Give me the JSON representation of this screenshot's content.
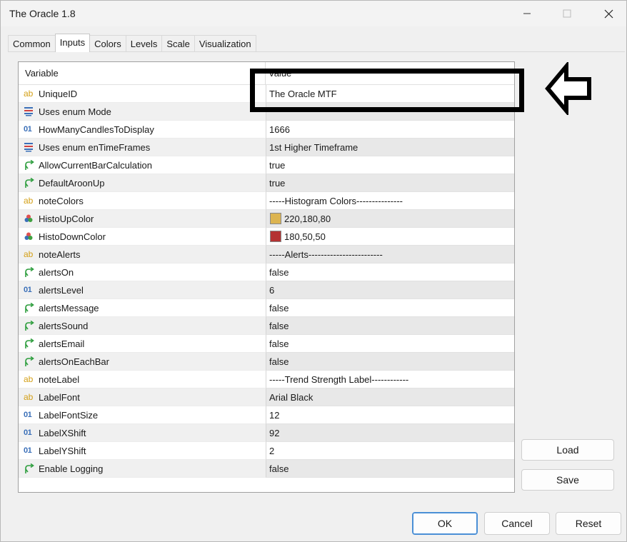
{
  "window": {
    "title": "The Oracle 1.8"
  },
  "tabs": [
    {
      "label": "Common",
      "active": false
    },
    {
      "label": "Inputs",
      "active": true
    },
    {
      "label": "Colors",
      "active": false
    },
    {
      "label": "Levels",
      "active": false
    },
    {
      "label": "Scale",
      "active": false
    },
    {
      "label": "Visualization",
      "active": false
    }
  ],
  "grid": {
    "headers": {
      "variable": "Variable",
      "value": "Value"
    },
    "rows": [
      {
        "name": "UniqueID",
        "icon": "ab",
        "value": "The Oracle MTF"
      },
      {
        "name": "Uses enum Mode",
        "icon": "enum",
        "value": ""
      },
      {
        "name": "HowManyCandlesToDisplay",
        "icon": "num",
        "value": "1666"
      },
      {
        "name": "Uses enum enTimeFrames",
        "icon": "enum",
        "value": "1st Higher Timeframe"
      },
      {
        "name": "AllowCurrentBarCalculation",
        "icon": "bool",
        "value": "true"
      },
      {
        "name": "DefaultAroonUp",
        "icon": "bool",
        "value": "true"
      },
      {
        "name": "noteColors",
        "icon": "ab",
        "value": "-----Histogram Colors---------------"
      },
      {
        "name": "HistoUpColor",
        "icon": "color",
        "value": "220,180,80",
        "swatch": "#dcb450"
      },
      {
        "name": "HistoDownColor",
        "icon": "color",
        "value": "180,50,50",
        "swatch": "#b43232"
      },
      {
        "name": "noteAlerts",
        "icon": "ab",
        "value": "-----Alerts------------------------"
      },
      {
        "name": "alertsOn",
        "icon": "bool",
        "value": "false"
      },
      {
        "name": "alertsLevel",
        "icon": "num",
        "value": "6"
      },
      {
        "name": "alertsMessage",
        "icon": "bool",
        "value": "false"
      },
      {
        "name": "alertsSound",
        "icon": "bool",
        "value": "false"
      },
      {
        "name": "alertsEmail",
        "icon": "bool",
        "value": "false"
      },
      {
        "name": "alertsOnEachBar",
        "icon": "bool",
        "value": "false"
      },
      {
        "name": "noteLabel",
        "icon": "ab",
        "value": "-----Trend Strength Label------------"
      },
      {
        "name": "LabelFont",
        "icon": "ab",
        "value": "Arial Black"
      },
      {
        "name": "LabelFontSize",
        "icon": "num",
        "value": "12"
      },
      {
        "name": "LabelXShift",
        "icon": "num",
        "value": "92"
      },
      {
        "name": "LabelYShift",
        "icon": "num",
        "value": "2"
      },
      {
        "name": "Enable Logging",
        "icon": "bool",
        "value": "false"
      }
    ]
  },
  "side_buttons": {
    "load": "Load",
    "save": "Save"
  },
  "footer_buttons": {
    "ok": "OK",
    "cancel": "Cancel",
    "reset": "Reset"
  },
  "colors": {
    "accent": "#4a8fd6",
    "ab_icon": "#d4a017",
    "num_icon": "#3a6fb8",
    "bool_icon": "#2e9e3e"
  }
}
